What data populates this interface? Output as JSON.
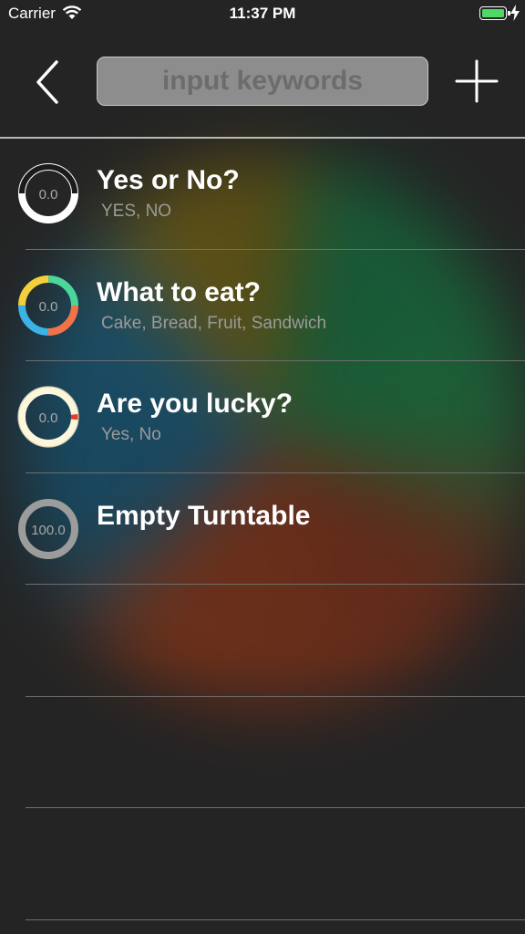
{
  "status_bar": {
    "carrier": "Carrier",
    "time": "11:37 PM",
    "wifi_icon": "wifi-icon",
    "battery_icon": "battery-charging-icon"
  },
  "nav": {
    "back_icon": "chevron-left-icon",
    "search_placeholder": "input keywords",
    "search_value": "",
    "add_icon": "plus-icon"
  },
  "turntables": [
    {
      "title": "Yes or No?",
      "options": "YES, NO",
      "score": "0.0",
      "colors": [
        "#ffffff",
        "#1b1b1b"
      ]
    },
    {
      "title": "What to eat?",
      "options": "Cake, Bread, Fruit, Sandwich",
      "score": "0.0",
      "colors": [
        "#4bd69a",
        "#f2734a",
        "#3cb3e6",
        "#f4cf3c"
      ]
    },
    {
      "title": "Are you lucky?",
      "options": "Yes, No",
      "score": "0.0",
      "colors": [
        "#fbf6dc",
        "#e83b2c"
      ]
    },
    {
      "title": "Empty Turntable",
      "options": "",
      "score": "100.0",
      "colors": [
        "#9c9c9c"
      ]
    }
  ],
  "empty_rows": 3,
  "colors": {
    "background": "#242424",
    "divider": "#6e6e6e",
    "subtitle": "#9b9b9b"
  }
}
